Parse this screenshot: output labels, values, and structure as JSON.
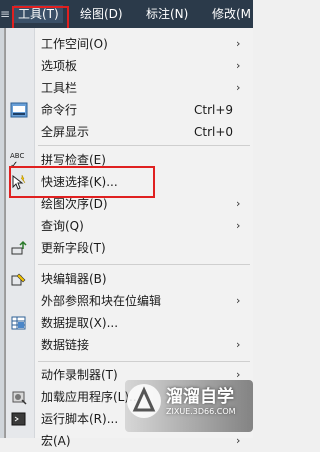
{
  "menubar": {
    "items": [
      {
        "label": "工具(T)"
      },
      {
        "label": "绘图(D)"
      },
      {
        "label": "标注(N)"
      },
      {
        "label": "修改(M"
      }
    ],
    "left_stub": "≡"
  },
  "menu": {
    "items": [
      {
        "label": "工作空间(O)",
        "shortcut": "",
        "submenu": true,
        "icon": ""
      },
      {
        "label": "选项板",
        "shortcut": "",
        "submenu": true,
        "icon": ""
      },
      {
        "label": "工具栏",
        "shortcut": "",
        "submenu": true,
        "icon": ""
      },
      {
        "label": "命令行",
        "shortcut": "Ctrl+9",
        "submenu": false,
        "icon": "command-line-icon"
      },
      {
        "label": "全屏显示",
        "shortcut": "Ctrl+0",
        "submenu": false,
        "icon": ""
      },
      {
        "label": "拼写检查(E)",
        "shortcut": "",
        "submenu": false,
        "icon": "spell-check-icon"
      },
      {
        "label": "快速选择(K)...",
        "shortcut": "",
        "submenu": false,
        "icon": "quick-select-icon"
      },
      {
        "label": "绘图次序(D)",
        "shortcut": "",
        "submenu": true,
        "icon": ""
      },
      {
        "label": "查询(Q)",
        "shortcut": "",
        "submenu": true,
        "icon": ""
      },
      {
        "label": "更新字段(T)",
        "shortcut": "",
        "submenu": false,
        "icon": "update-fields-icon"
      },
      {
        "label": "块编辑器(B)",
        "shortcut": "",
        "submenu": false,
        "icon": "block-editor-icon"
      },
      {
        "label": "外部参照和块在位编辑",
        "shortcut": "",
        "submenu": true,
        "icon": ""
      },
      {
        "label": "数据提取(X)...",
        "shortcut": "",
        "submenu": false,
        "icon": "data-extraction-icon"
      },
      {
        "label": "数据链接",
        "shortcut": "",
        "submenu": true,
        "icon": ""
      },
      {
        "label": "动作录制器(T)",
        "shortcut": "",
        "submenu": true,
        "icon": ""
      },
      {
        "label": "加载应用程序(L)...",
        "shortcut": "",
        "submenu": false,
        "icon": "load-application-icon"
      },
      {
        "label": "运行脚本(R)...",
        "shortcut": "",
        "submenu": false,
        "icon": "run-script-icon"
      },
      {
        "label": "宏(A)",
        "shortcut": "",
        "submenu": true,
        "icon": ""
      }
    ],
    "arrow_glyph": "›",
    "spell_icon_text": "ABC"
  },
  "watermark": {
    "main": "溜溜自学",
    "url": "ZIXUE.3D66.COM"
  },
  "colors": {
    "menubar_bg": "#2b3a4a",
    "highlight_box": "#e02020",
    "menu_bg": "#f2f2f2"
  }
}
